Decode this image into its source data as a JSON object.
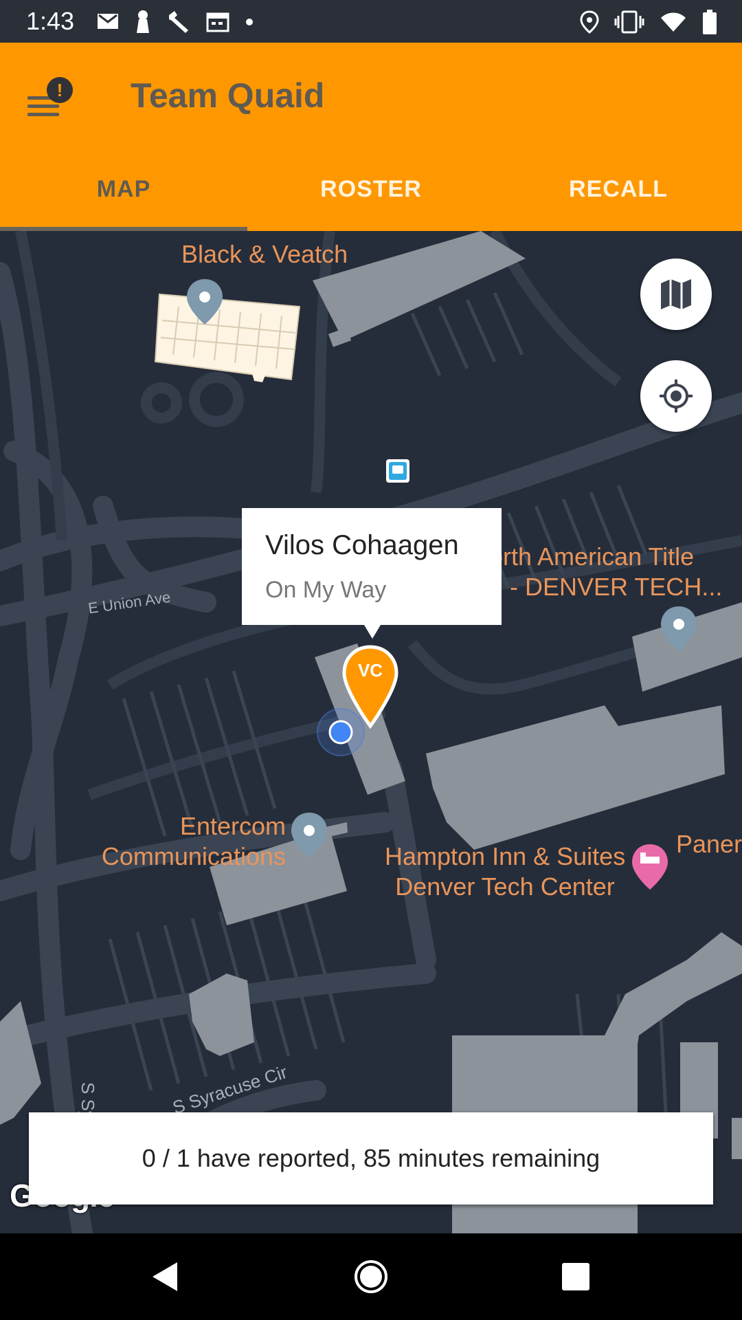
{
  "status_bar": {
    "time": "1:43",
    "left_icons": [
      "gmail-icon",
      "keyhole-icon",
      "wrench-icon",
      "calendar-icon",
      "dot-icon"
    ],
    "right_icons": [
      "location-icon",
      "vibrate-icon",
      "wifi-icon",
      "battery-icon"
    ]
  },
  "app_bar": {
    "title": "Team Quaid",
    "menu_badge": "!",
    "accent_color": "#ff9800"
  },
  "tabs": [
    {
      "label": "MAP",
      "active": true
    },
    {
      "label": "ROSTER",
      "active": false
    },
    {
      "label": "RECALL",
      "active": false
    }
  ],
  "map": {
    "places": {
      "black_veatch": "Black & Veatch",
      "north_american_title_line1": "orth American Title",
      "north_american_title_line2": "- DENVER TECH...",
      "entercom_line1": "Entercom",
      "entercom_line2": "Communications",
      "hampton_line1": "Hampton Inn & Suites",
      "hampton_line2": "Denver Tech Center",
      "panera": "Panera"
    },
    "streets": {
      "union": "E Union Ave",
      "syracuse_cir": "S Syracuse Cir",
      "s_sy": "S Sy"
    },
    "info_window": {
      "name": "Vilos Cohaagen",
      "status": "On My Way"
    },
    "marker_initials": "VC",
    "attribution": "Google"
  },
  "report": {
    "text": "0 / 1 have reported, 85 minutes remaining"
  }
}
